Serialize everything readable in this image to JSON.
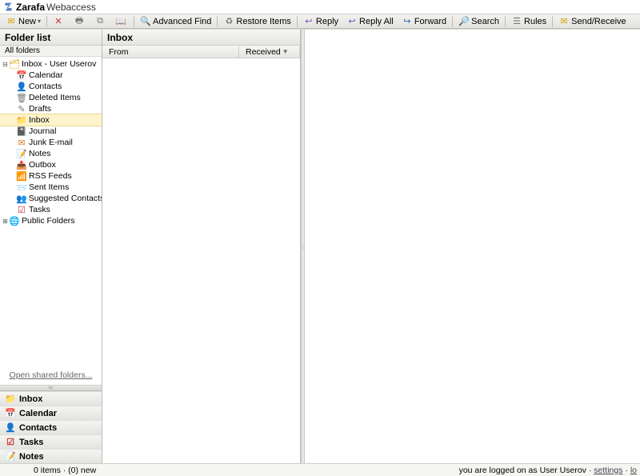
{
  "app": {
    "brand": "Zarafa",
    "brand_sub": "Webaccess"
  },
  "toolbar": {
    "new": "New",
    "advanced_find": "Advanced Find",
    "restore_items": "Restore Items",
    "reply": "Reply",
    "reply_all": "Reply All",
    "forward": "Forward",
    "search": "Search",
    "rules": "Rules",
    "send_receive": "Send/Receive"
  },
  "sidebar": {
    "title": "Folder list",
    "subtitle": "All folders",
    "root": "Inbox - User Userov",
    "items": [
      {
        "label": "Calendar"
      },
      {
        "label": "Contacts"
      },
      {
        "label": "Deleted Items"
      },
      {
        "label": "Drafts"
      },
      {
        "label": "Inbox"
      },
      {
        "label": "Journal"
      },
      {
        "label": "Junk E-mail"
      },
      {
        "label": "Notes"
      },
      {
        "label": "Outbox"
      },
      {
        "label": "RSS Feeds"
      },
      {
        "label": "Sent Items"
      },
      {
        "label": "Suggested Contacts"
      },
      {
        "label": "Tasks"
      }
    ],
    "public_folders": "Public Folders",
    "open_shared": "Open shared folders...",
    "nav": {
      "inbox": "Inbox",
      "calendar": "Calendar",
      "contacts": "Contacts",
      "tasks": "Tasks",
      "notes": "Notes"
    }
  },
  "list": {
    "title": "Inbox",
    "col_from": "From",
    "col_received": "Received",
    "sort_indicator": "▼"
  },
  "status": {
    "left": "0 items · (0) new",
    "right_prefix": "you are logged on as ",
    "user": "User Userov",
    "sep": " · ",
    "settings": "settings",
    "logout": "lo"
  }
}
